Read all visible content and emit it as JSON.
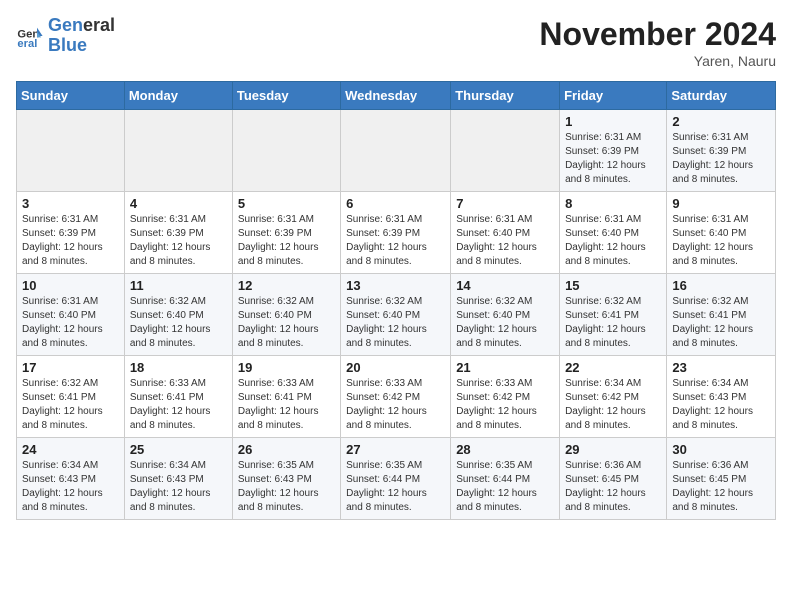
{
  "logo": {
    "line1": "General",
    "line2": "Blue"
  },
  "title": "November 2024",
  "location": "Yaren, Nauru",
  "weekdays": [
    "Sunday",
    "Monday",
    "Tuesday",
    "Wednesday",
    "Thursday",
    "Friday",
    "Saturday"
  ],
  "weeks": [
    [
      {
        "day": "",
        "detail": ""
      },
      {
        "day": "",
        "detail": ""
      },
      {
        "day": "",
        "detail": ""
      },
      {
        "day": "",
        "detail": ""
      },
      {
        "day": "",
        "detail": ""
      },
      {
        "day": "1",
        "detail": "Sunrise: 6:31 AM\nSunset: 6:39 PM\nDaylight: 12 hours and 8 minutes."
      },
      {
        "day": "2",
        "detail": "Sunrise: 6:31 AM\nSunset: 6:39 PM\nDaylight: 12 hours and 8 minutes."
      }
    ],
    [
      {
        "day": "3",
        "detail": "Sunrise: 6:31 AM\nSunset: 6:39 PM\nDaylight: 12 hours and 8 minutes."
      },
      {
        "day": "4",
        "detail": "Sunrise: 6:31 AM\nSunset: 6:39 PM\nDaylight: 12 hours and 8 minutes."
      },
      {
        "day": "5",
        "detail": "Sunrise: 6:31 AM\nSunset: 6:39 PM\nDaylight: 12 hours and 8 minutes."
      },
      {
        "day": "6",
        "detail": "Sunrise: 6:31 AM\nSunset: 6:39 PM\nDaylight: 12 hours and 8 minutes."
      },
      {
        "day": "7",
        "detail": "Sunrise: 6:31 AM\nSunset: 6:40 PM\nDaylight: 12 hours and 8 minutes."
      },
      {
        "day": "8",
        "detail": "Sunrise: 6:31 AM\nSunset: 6:40 PM\nDaylight: 12 hours and 8 minutes."
      },
      {
        "day": "9",
        "detail": "Sunrise: 6:31 AM\nSunset: 6:40 PM\nDaylight: 12 hours and 8 minutes."
      }
    ],
    [
      {
        "day": "10",
        "detail": "Sunrise: 6:31 AM\nSunset: 6:40 PM\nDaylight: 12 hours and 8 minutes."
      },
      {
        "day": "11",
        "detail": "Sunrise: 6:32 AM\nSunset: 6:40 PM\nDaylight: 12 hours and 8 minutes."
      },
      {
        "day": "12",
        "detail": "Sunrise: 6:32 AM\nSunset: 6:40 PM\nDaylight: 12 hours and 8 minutes."
      },
      {
        "day": "13",
        "detail": "Sunrise: 6:32 AM\nSunset: 6:40 PM\nDaylight: 12 hours and 8 minutes."
      },
      {
        "day": "14",
        "detail": "Sunrise: 6:32 AM\nSunset: 6:40 PM\nDaylight: 12 hours and 8 minutes."
      },
      {
        "day": "15",
        "detail": "Sunrise: 6:32 AM\nSunset: 6:41 PM\nDaylight: 12 hours and 8 minutes."
      },
      {
        "day": "16",
        "detail": "Sunrise: 6:32 AM\nSunset: 6:41 PM\nDaylight: 12 hours and 8 minutes."
      }
    ],
    [
      {
        "day": "17",
        "detail": "Sunrise: 6:32 AM\nSunset: 6:41 PM\nDaylight: 12 hours and 8 minutes."
      },
      {
        "day": "18",
        "detail": "Sunrise: 6:33 AM\nSunset: 6:41 PM\nDaylight: 12 hours and 8 minutes."
      },
      {
        "day": "19",
        "detail": "Sunrise: 6:33 AM\nSunset: 6:41 PM\nDaylight: 12 hours and 8 minutes."
      },
      {
        "day": "20",
        "detail": "Sunrise: 6:33 AM\nSunset: 6:42 PM\nDaylight: 12 hours and 8 minutes."
      },
      {
        "day": "21",
        "detail": "Sunrise: 6:33 AM\nSunset: 6:42 PM\nDaylight: 12 hours and 8 minutes."
      },
      {
        "day": "22",
        "detail": "Sunrise: 6:34 AM\nSunset: 6:42 PM\nDaylight: 12 hours and 8 minutes."
      },
      {
        "day": "23",
        "detail": "Sunrise: 6:34 AM\nSunset: 6:43 PM\nDaylight: 12 hours and 8 minutes."
      }
    ],
    [
      {
        "day": "24",
        "detail": "Sunrise: 6:34 AM\nSunset: 6:43 PM\nDaylight: 12 hours and 8 minutes."
      },
      {
        "day": "25",
        "detail": "Sunrise: 6:34 AM\nSunset: 6:43 PM\nDaylight: 12 hours and 8 minutes."
      },
      {
        "day": "26",
        "detail": "Sunrise: 6:35 AM\nSunset: 6:43 PM\nDaylight: 12 hours and 8 minutes."
      },
      {
        "day": "27",
        "detail": "Sunrise: 6:35 AM\nSunset: 6:44 PM\nDaylight: 12 hours and 8 minutes."
      },
      {
        "day": "28",
        "detail": "Sunrise: 6:35 AM\nSunset: 6:44 PM\nDaylight: 12 hours and 8 minutes."
      },
      {
        "day": "29",
        "detail": "Sunrise: 6:36 AM\nSunset: 6:45 PM\nDaylight: 12 hours and 8 minutes."
      },
      {
        "day": "30",
        "detail": "Sunrise: 6:36 AM\nSunset: 6:45 PM\nDaylight: 12 hours and 8 minutes."
      }
    ]
  ]
}
